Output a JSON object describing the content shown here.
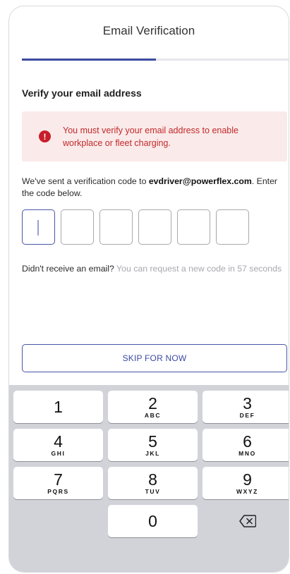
{
  "header": {
    "title": "Email Verification"
  },
  "progress": {
    "fraction": 0.5,
    "color": "#3b4aa0"
  },
  "section": {
    "title": "Verify your email address"
  },
  "alert": {
    "icon": "exclamation-icon",
    "message": "You must verify your email address to enable workplace or fleet charging."
  },
  "info": {
    "prefix": "We've sent a verification code to ",
    "email": "evdriver@powerflex.com",
    "suffix": ". Enter the code below."
  },
  "code": {
    "length": 6,
    "values": [
      "",
      "",
      "",
      "",
      "",
      ""
    ]
  },
  "resend": {
    "prompt": "Didn't receive an email?",
    "countdown": " You can request a new code in 57 seconds"
  },
  "skip": {
    "label": "SKIP FOR NOW"
  },
  "keypad": {
    "keys": [
      {
        "num": "1",
        "letters": ""
      },
      {
        "num": "2",
        "letters": "ABC"
      },
      {
        "num": "3",
        "letters": "DEF"
      },
      {
        "num": "4",
        "letters": "GHI"
      },
      {
        "num": "5",
        "letters": "JKL"
      },
      {
        "num": "6",
        "letters": "MNO"
      },
      {
        "num": "7",
        "letters": "PQRS"
      },
      {
        "num": "8",
        "letters": "TUV"
      },
      {
        "num": "9",
        "letters": "WXYZ"
      },
      {
        "num": "0",
        "letters": ""
      }
    ],
    "backspace_icon": "backspace-icon"
  },
  "colors": {
    "accent": "#3b4aa0",
    "error": "#c81e2a",
    "error_bg": "#fbeaea"
  }
}
